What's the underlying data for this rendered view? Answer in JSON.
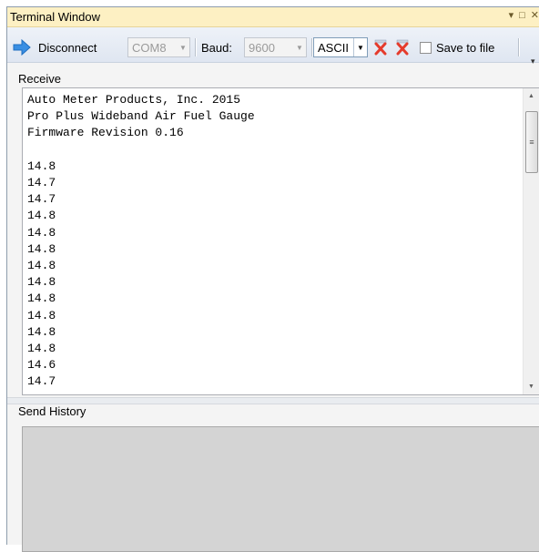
{
  "window": {
    "title": "Terminal Window",
    "controls": [
      "▾",
      "□",
      "✕"
    ]
  },
  "toolbar": {
    "disconnect_label": "Disconnect",
    "port_value": "COM8",
    "baud_label": "Baud:",
    "baud_value": "9600",
    "encoding_value": "ASCII",
    "save_to_file_label": "Save to file",
    "save_to_file_checked": false
  },
  "receive": {
    "label": "Receive",
    "lines": [
      "Auto Meter Products, Inc. 2015",
      "Pro Plus Wideband Air Fuel Gauge",
      "Firmware Revision 0.16",
      "",
      "14.8",
      "14.7",
      "14.7",
      "14.8",
      "14.8",
      "14.8",
      "14.8",
      "14.8",
      "14.8",
      "14.8",
      "14.8",
      "14.8",
      "14.6",
      "14.7"
    ]
  },
  "send_history": {
    "label": "Send History"
  },
  "colors": {
    "title_bar": "#fdf0c3",
    "toolbar": "#e6ecf5",
    "arrow_icon": "#3a8fe3",
    "clear_icon": "#e53b2c"
  }
}
